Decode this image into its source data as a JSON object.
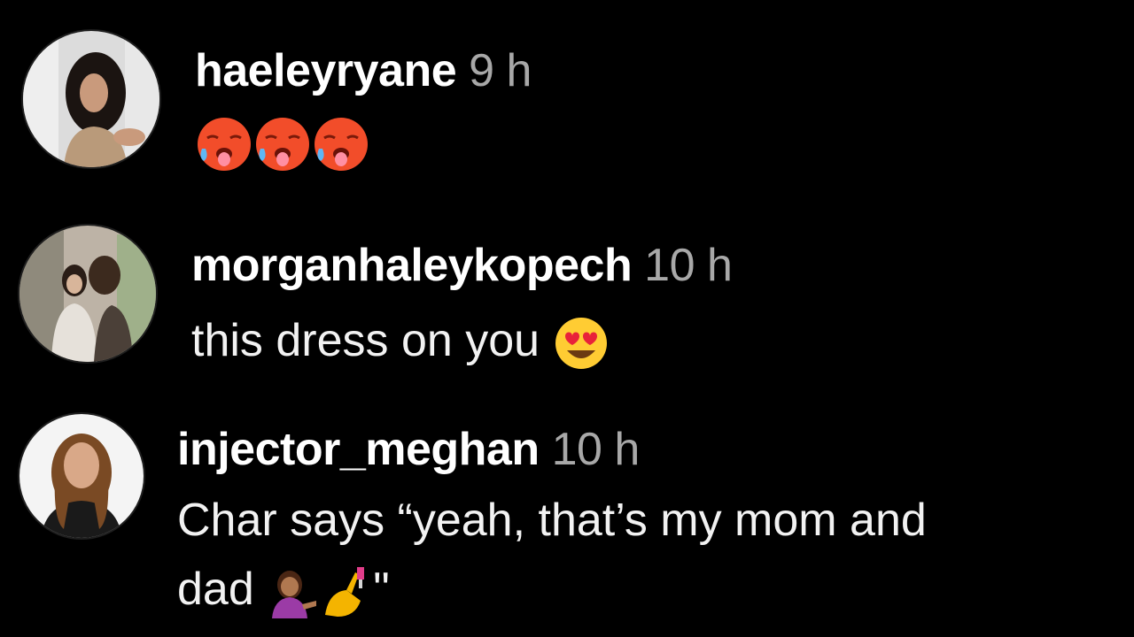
{
  "comments": [
    {
      "username": "haeleyryane",
      "time": "9 h",
      "text": "",
      "emojis": [
        "hot-face-emoji",
        "hot-face-emoji",
        "hot-face-emoji"
      ]
    },
    {
      "username": "morganhaleykopech",
      "time": "10 h",
      "text": "this dress on you",
      "emojis": [
        "heart-eyes-emoji"
      ]
    },
    {
      "username": "injector_meghan",
      "time": "10 h",
      "text_line1": "Char says “yeah, that’s my mom and",
      "text_line2_before": "dad",
      "text_line2_after": "\"",
      "emojis": [
        "tipping-hand-person-emoji",
        "nail-polish-emoji"
      ]
    }
  ],
  "colors": {
    "background": "#000000",
    "username": "#ffffff",
    "timestamp": "#a8a8a8",
    "body_text": "#f2f2f2"
  }
}
